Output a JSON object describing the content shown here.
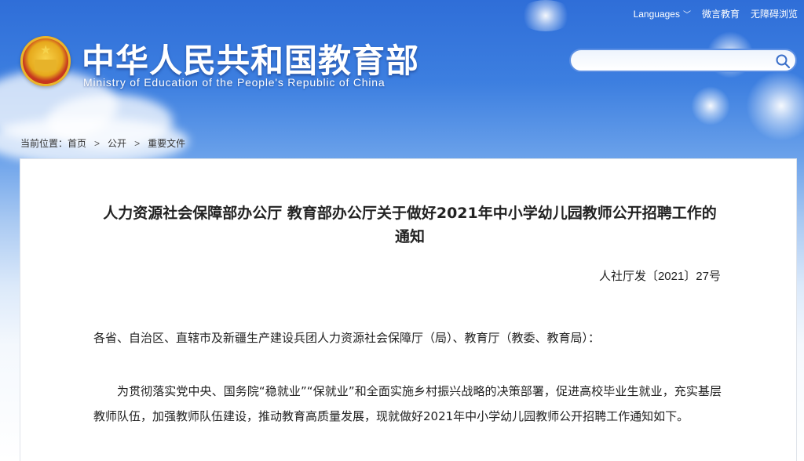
{
  "header": {
    "title_cn": "中华人民共和国教育部",
    "title_en": "Ministry of Education of the People's Republic of China",
    "links": {
      "languages": "Languages",
      "weibo": "微言教育",
      "accessibility": "无障碍浏览"
    },
    "search": {
      "placeholder": "",
      "value": ""
    }
  },
  "breadcrumb": {
    "prefix": "当前位置：",
    "items": [
      "首页",
      "公开",
      "重要文件"
    ],
    "separator": ">"
  },
  "article": {
    "title": "人力资源社会保障部办公厅 教育部办公厅关于做好2021年中小学幼儿园教师公开招聘工作的通知",
    "doc_number": "人社厅发〔2021〕27号",
    "addressee": "各省、自治区、直辖市及新疆生产建设兵团人力资源社会保障厅（局）、教育厅（教委、教育局）：",
    "paragraph": "为贯彻落实党中央、国务院“稳就业”“保就业”和全面实施乡村振兴战略的决策部署，促进高校毕业生就业，充实基层教师队伍，加强教师队伍建设，推动教育高质量发展，现就做好2021年中小学幼儿园教师公开招聘工作通知如下。"
  },
  "colors": {
    "banner_top": "#2f6ed8",
    "search_border": "#5c8fe3",
    "text": "#222222"
  },
  "icons": {
    "emblem": "national-emblem-icon",
    "search": "search-icon",
    "chevron": "chevron-down-icon"
  }
}
